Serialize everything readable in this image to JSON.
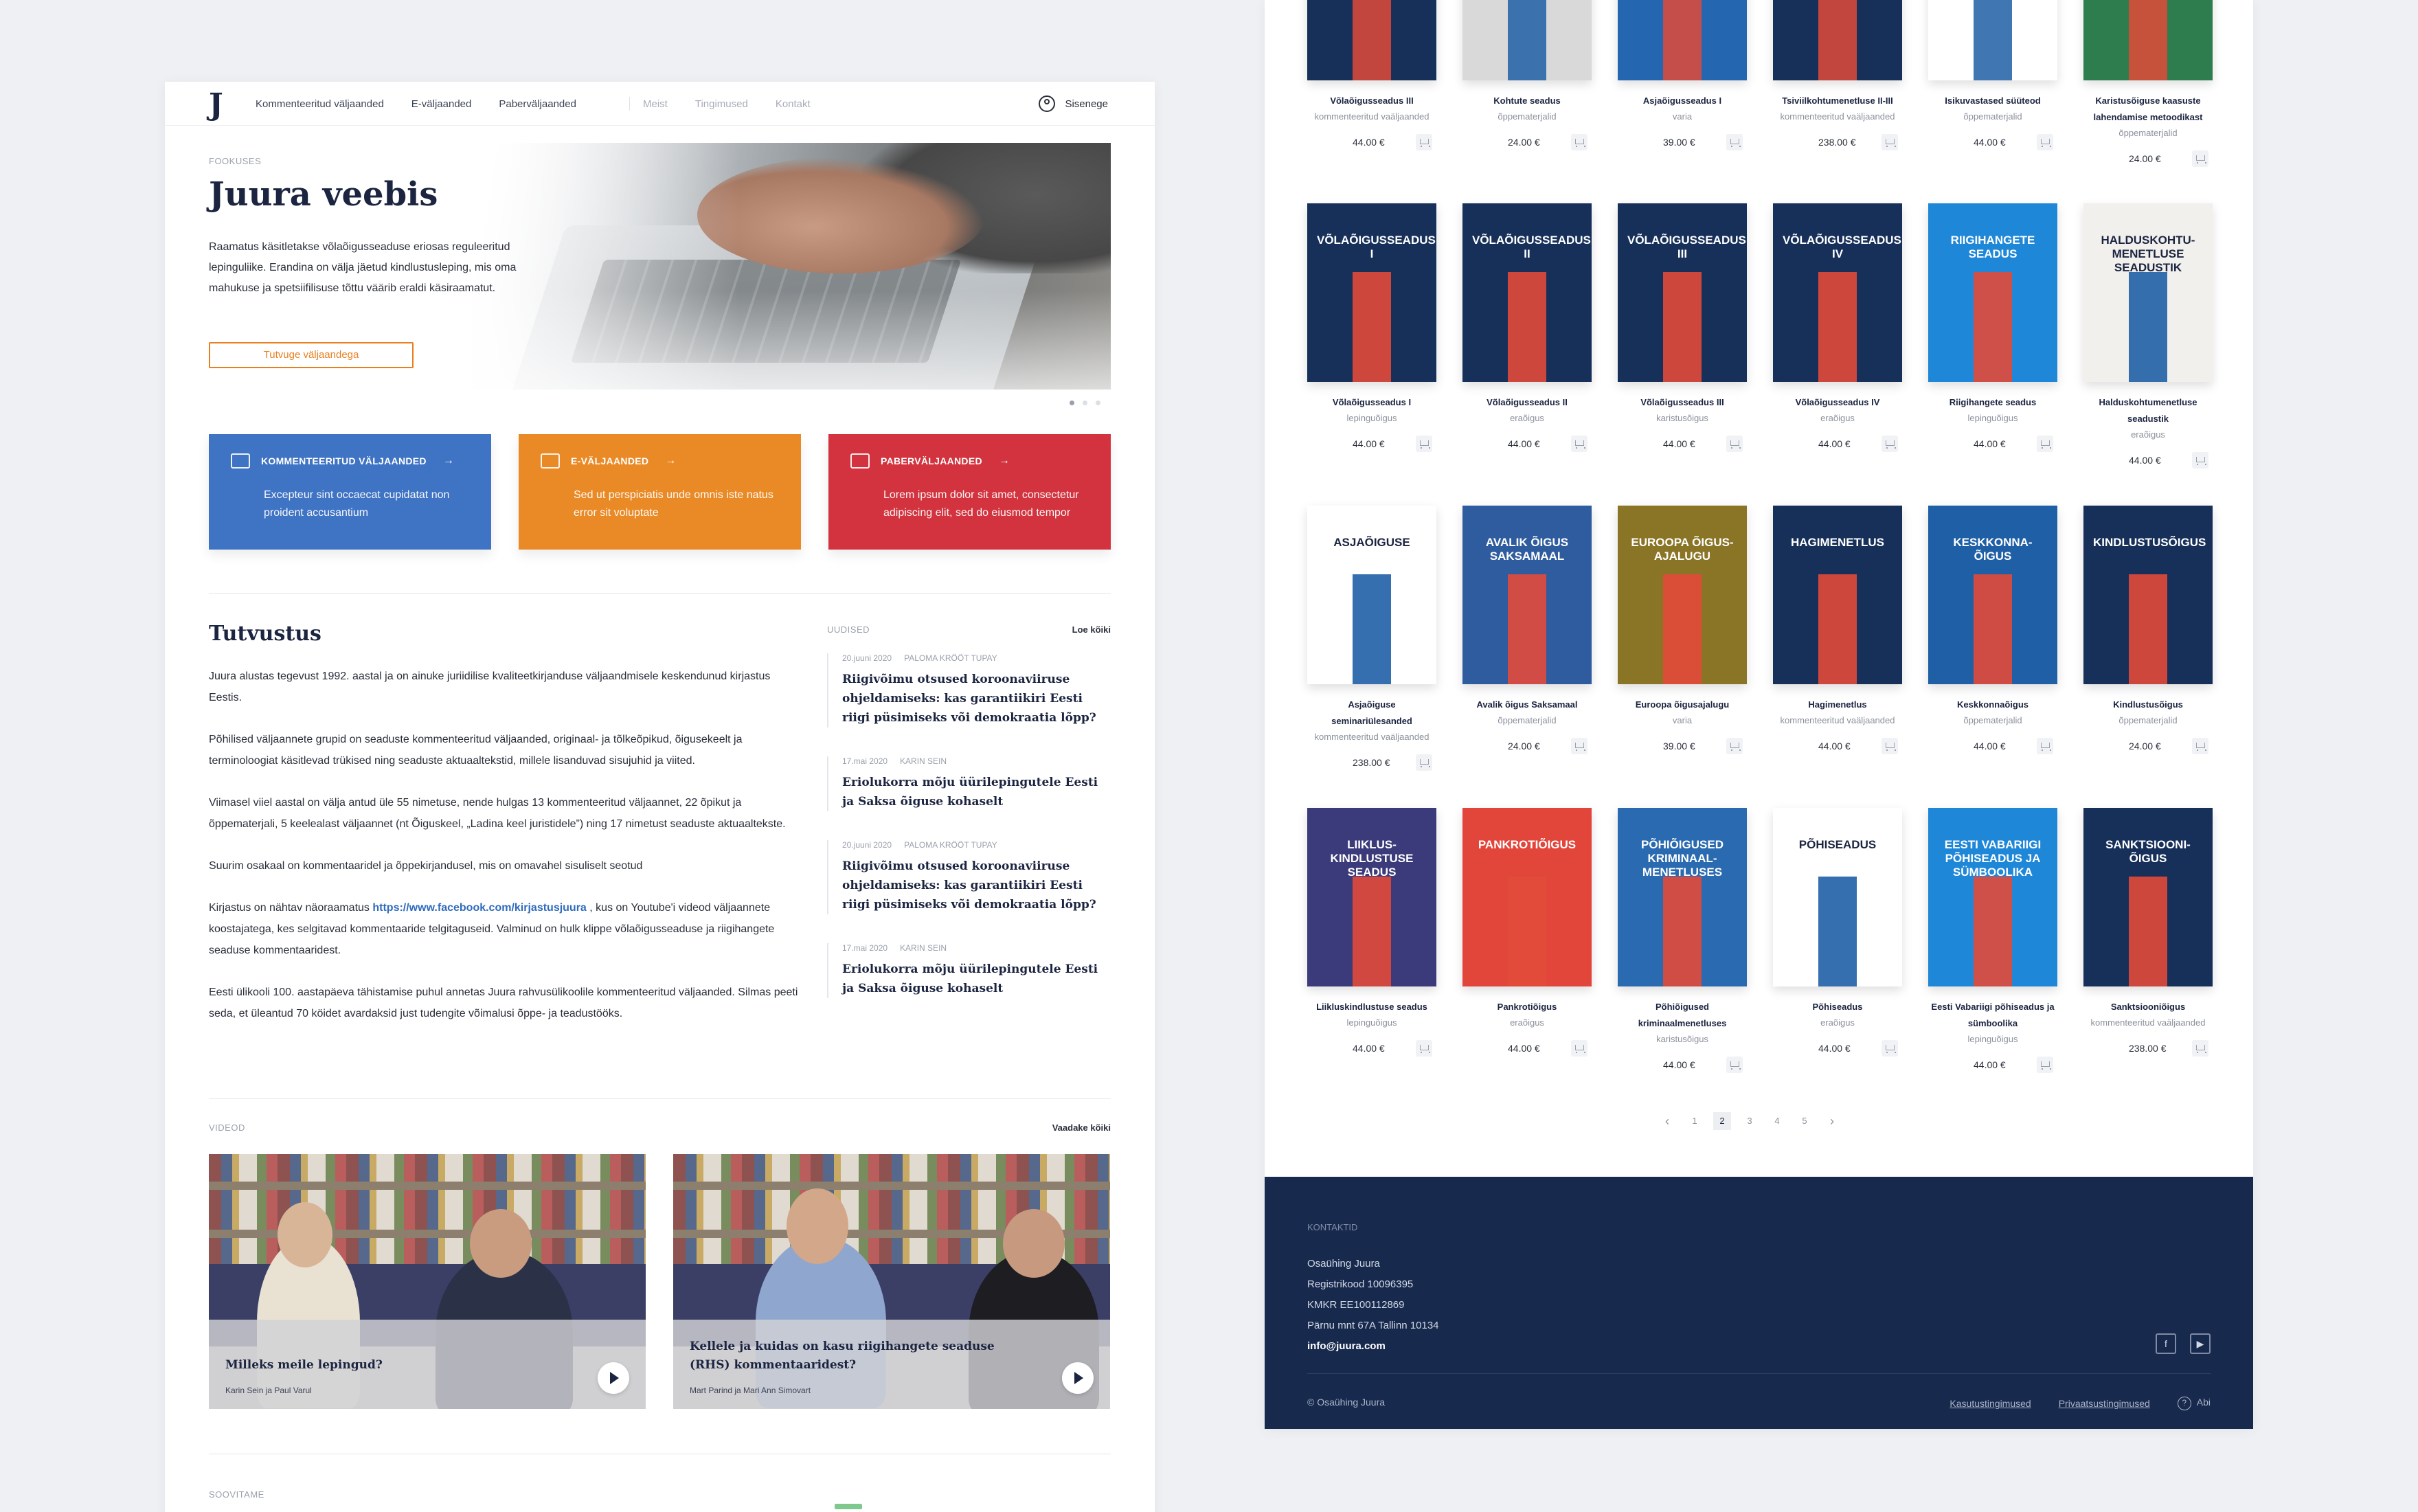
{
  "nav": {
    "links": [
      "Kommenteeritud väljaanded",
      "E-väljaanded",
      "Paberväljaanded"
    ],
    "secondary": [
      "Meist",
      "Tingimused",
      "Kontakt"
    ],
    "signin": "Sisenege"
  },
  "hero": {
    "eyebrow": "FOOKUSES",
    "title": "Juura veebis",
    "text": "Raamatus käsitletakse võlaõigusseaduse eriosas reguleeritud lepinguliike. Erandina on välja jäetud kindlustusleping, mis oma mahukuse ja spetsiifilisuse tõttu väärib eraldi käsiraamatut.",
    "button": "Tutvuge väljaandega"
  },
  "categories": [
    {
      "title": "KOMMENTEERITUD VÄLJAANDED",
      "desc": "Excepteur sint occaecat cupidatat non proident accusantium",
      "color": "#3f73c3"
    },
    {
      "title": "E-VÄLJAANDED",
      "desc": "Sed ut perspiciatis unde omnis iste natus error sit voluptate",
      "color": "#ea8a26"
    },
    {
      "title": "PABERVÄLJAANDED",
      "desc": "Lorem ipsum dolor sit amet, consectetur adipiscing elit, sed do eiusmod tempor",
      "color": "#d2333e"
    }
  ],
  "about": {
    "title": "Tutvustus",
    "paragraphs": [
      "Juura alustas tegevust 1992. aastal ja on ainuke juriidilise kvaliteetkirjanduse väljaandmisele keskendunud kirjastus Eestis.",
      "Põhilised väljaannete grupid on seaduste kommenteeritud väljaanded, originaal- ja tõlkeõpikud, õigusekeelt ja terminoloogiat käsitlevad trükised ning seaduste aktuaaltekstid, millele lisanduvad sisujuhid ja viited.",
      "Viimasel viiel aastal on välja antud üle 55 nimetuse, nende hulgas 13 kommenteeritud väljaannet, 22 õpikut ja õppematerjali, 5 keelealast väljaannet (nt Õiguskeel, „Ladina keel juristidele”) ning 17 nimetust seaduste aktuaaltekste.",
      "Suurim osakaal on kommentaaridel ja õppekirjandusel, mis on omavahel sisuliselt seotud"
    ],
    "p5_pre": "Kirjastus on nähtav näoraamatus ",
    "p5_link": "https://www.facebook.com/kirjastusjuura",
    "p5_post": " , kus on Youtube'i videod väljaannete koostajatega, kes selgitavad kommentaaride telgitaguseid. Valminud on hulk klippe võlaõigusseaduse ja riigihangete seaduse kommentaaridest.",
    "p6": "Eesti ülikooli 100. aastapäeva tähistamise puhul annetas Juura rahvusülikoolile kommenteeritud väljaanded. Silmas peeti seda, et üleantud 70 köidet avardaksid just tudengite võimalusi õppe- ja teadustööks."
  },
  "news": {
    "heading": "UUDISED",
    "link": "Loe kõiki",
    "items": [
      {
        "date": "20.juuni 2020",
        "author": "PALOMA KRÖÖT TUPAY",
        "title": "Riigivõimu otsused koroonaviiruse ohjeldamiseks: kas garantiikiri Eesti riigi püsimiseks või demokraatia lõpp?"
      },
      {
        "date": "17.mai 2020",
        "author": "KARIN SEIN",
        "title": "Eriolukorra mõju üürilepingutele Eesti ja Saksa õiguse kohaselt"
      },
      {
        "date": "20.juuni 2020",
        "author": "PALOMA KRÖÖT TUPAY",
        "title": "Riigivõimu otsused koroonaviiruse ohjeldamiseks: kas garantiikiri Eesti riigi püsimiseks või demokraatia lõpp?"
      },
      {
        "date": "17.mai 2020",
        "author": "KARIN SEIN",
        "title": "Eriolukorra mõju üürilepingutele Eesti ja Saksa õiguse kohaselt"
      }
    ]
  },
  "videos": {
    "heading": "VIDEOD",
    "link": "Vaadake kõiki",
    "items": [
      {
        "title": "Milleks meile lepingud?",
        "sub": "Karin Sein ja Paul Varul"
      },
      {
        "title": "Kellele ja kuidas on kasu riigihangete seaduse (RHS) kommentaaridest?",
        "sub": "Mart Parind ja Mari Ann Simovart"
      }
    ]
  },
  "recommend": "SOOVITAME",
  "books": [
    {
      "title": "Võlaõigusseadus III",
      "cat": "kommenteeritud vaäljaanded",
      "price": "44.00 €",
      "bg": "#17305a",
      "cover": ""
    },
    {
      "title": "Kohtute seadus",
      "cat": "õppematerjalid",
      "price": "24.00 €",
      "bg": "#d9d9d9",
      "cover": ""
    },
    {
      "title": "Asjaõigusseadus I",
      "cat": "varia",
      "price": "39.00 €",
      "bg": "#2467b0",
      "cover": ""
    },
    {
      "title": "Tsiviilkohtumenetluse II-III",
      "cat": "kommenteeritud vaäljaanded",
      "price": "238.00 €",
      "bg": "#17305a",
      "cover": ""
    },
    {
      "title": "Isikuvastased süüteod",
      "cat": "õppematerjalid",
      "price": "44.00 €",
      "bg": "#ffffff",
      "cover": ""
    },
    {
      "title": "Karistusõiguse kaasuste lahendamise metoodikast",
      "cat": "õppematerjalid",
      "price": "24.00 €",
      "bg": "#2d7d4e",
      "cover": ""
    },
    {
      "title": "Võlaõigusseadus I",
      "cat": "lepinguõigus",
      "price": "44.00 €",
      "bg": "#17305a",
      "cover": "VÕLAÕIGUSSEADUS I"
    },
    {
      "title": "Võlaõigusseadus II",
      "cat": "eraõigus",
      "price": "44.00 €",
      "bg": "#17305a",
      "cover": "VÕLAÕIGUSSEADUS II"
    },
    {
      "title": "Võlaõigusseadus III",
      "cat": "karistusõigus",
      "price": "44.00 €",
      "bg": "#17305a",
      "cover": "VÕLAÕIGUSSEADUS III"
    },
    {
      "title": "Võlaõigusseadus IV",
      "cat": "eraõigus",
      "price": "44.00 €",
      "bg": "#17305a",
      "cover": "VÕLAÕIGUSSEADUS IV"
    },
    {
      "title": "Riigihangete seadus",
      "cat": "lepinguõigus",
      "price": "44.00 €",
      "bg": "#1f87d8",
      "cover": "RIIGIHANGETE SEADUS"
    },
    {
      "title": "Halduskohtumenetluse seadustik",
      "cat": "eraõigus",
      "price": "44.00 €",
      "bg": "#f1f0ec",
      "cover": "HALDUSKOHTU-MENETLUSE SEADUSTIK"
    },
    {
      "title": "Asjaõiguse seminariülesanded",
      "cat": "kommenteeritud vaäljaanded",
      "price": "238.00 €",
      "bg": "#ffffff",
      "cover": "ASJAÕIGUSE"
    },
    {
      "title": "Avalik õigus Saksamaal",
      "cat": "õppematerjalid",
      "price": "24.00 €",
      "bg": "#2f5c9e",
      "cover": "AVALIK ÕIGUS SAKSAMAAL"
    },
    {
      "title": "Euroopa õigusajalugu",
      "cat": "varia",
      "price": "39.00 €",
      "bg": "#8a7426",
      "cover": "EUROOPA ÕIGUS-AJALUGU"
    },
    {
      "title": "Hagimenetlus",
      "cat": "kommenteeritud vaäljaanded",
      "price": "44.00 €",
      "bg": "#17305a",
      "cover": "HAGIMENETLUS"
    },
    {
      "title": "Keskkonnaõigus",
      "cat": "õppematerjalid",
      "price": "44.00 €",
      "bg": "#1f5fa6",
      "cover": "KESKKONNA-ÕIGUS"
    },
    {
      "title": "Kindlustusõigus",
      "cat": "õppematerjalid",
      "price": "24.00 €",
      "bg": "#17305a",
      "cover": "KINDLUSTUSÕIGUS"
    },
    {
      "title": "Liikluskindlustuse seadus",
      "cat": "lepinguõigus",
      "price": "44.00 €",
      "bg": "#3b3a7a",
      "cover": "LIIKLUS-KINDLUSTUSE SEADUS"
    },
    {
      "title": "Pankrotiõigus",
      "cat": "eraõigus",
      "price": "44.00 €",
      "bg": "#e2463b",
      "cover": "PANKROTIÕIGUS"
    },
    {
      "title": "Põhiõigused kriminaalmenetluses",
      "cat": "karistusõigus",
      "price": "44.00 €",
      "bg": "#2a6ab0",
      "cover": "PÕHIÕIGUSED KRIMINAAL-MENETLUSES"
    },
    {
      "title": "Põhiseadus",
      "cat": "eraõigus",
      "price": "44.00 €",
      "bg": "#ffffff",
      "cover": "PÕHISEADUS"
    },
    {
      "title": "Eesti Vabariigi põhiseadus ja sümboolika",
      "cat": "lepinguõigus",
      "price": "44.00 €",
      "bg": "#1f87d8",
      "cover": "EESTI VABARIIGI PÕHISEADUS JA SÜMBOOLIKA"
    },
    {
      "title": "Sanktsiooniõigus",
      "cat": "kommenteeritud vaäljaanded",
      "price": "238.00 €",
      "bg": "#17305a",
      "cover": "SANKTSIOONI-ÕIGUS"
    }
  ],
  "pager": {
    "pages": [
      "1",
      "2",
      "3",
      "4",
      "5"
    ],
    "current": "2"
  },
  "footer": {
    "heading": "KONTAKTID",
    "company": "Osaühing Juura",
    "reg": "Registrikood 10096395",
    "kmkr": "KMKR EE100112869",
    "address": "Pärnu mnt 67A Tallinn 10134",
    "email": "info@juura.com",
    "copyright": "©  Osaühing Juura",
    "terms": "Kasutustingimused",
    "privacy": "Privaatsustingimused",
    "help": "Abi"
  }
}
